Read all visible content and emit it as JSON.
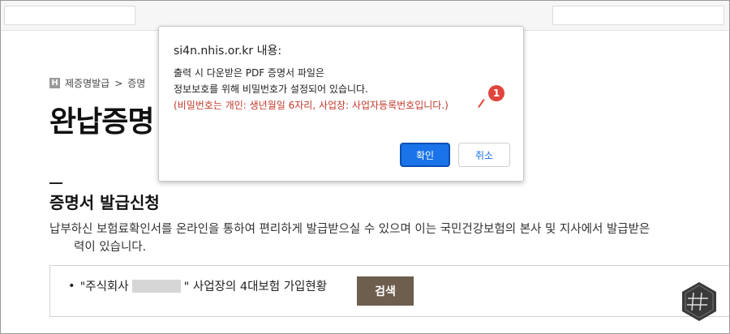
{
  "breadcrumb": {
    "home_icon_letter": "H",
    "item1": "제증명발급",
    "separator": ">",
    "item2": "증명"
  },
  "page": {
    "title": "완납증명"
  },
  "section": {
    "title": "증명서 발급신청",
    "desc_line1": "납부하신 보험료확인서를 온라인을 통하여 편리하게 발급받으실 수 있으며 이는 국민건강보험의 본사 및 지사에서 발급받은",
    "desc_line2": "력이 있습니다."
  },
  "search": {
    "bullet": "•",
    "text_before": "\"주식회사",
    "text_after": "\" 사업장의 4대보험 가입현황",
    "button_label": "검색"
  },
  "dialog": {
    "title": "si4n.nhis.or.kr 내용:",
    "line1": "출력 시 다운받은 PDF 증명서 파일은",
    "line2": "정보보호를 위해 비밀번호가 설정되어 있습니다.",
    "line3": "(비밀번호는 개인: 생년월일 6자리, 사업장: 사업자등록번호입니다.)",
    "badge": "1",
    "confirm_label": "확인",
    "cancel_label": "취소"
  },
  "colors": {
    "accent": "#1a73e8",
    "search_button": "#6e5e4e",
    "highlight_text": "#c0392b",
    "badge": "#e0453d"
  }
}
